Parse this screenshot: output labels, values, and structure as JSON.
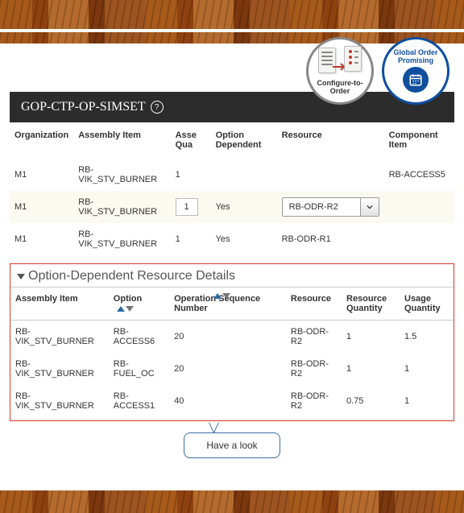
{
  "badges": {
    "c2o_label": "Configure-to-Order",
    "gop_label": "Global Order Promising"
  },
  "title": "GOP-CTP-OP-SIMSET",
  "main_table": {
    "headers": {
      "org": "Organization",
      "assembly_item": "Assembly Item",
      "assembly_qty": "Asse Qua",
      "option_dep": "Option Dependent",
      "resource": "Resource",
      "component_item": "Component Item"
    },
    "rows": [
      {
        "org": "M1",
        "assembly_item": "RB-VIK_STV_BURNER",
        "assembly_qty": "1",
        "option_dep": "",
        "resource": "",
        "component_item": "RB-ACCESS5"
      },
      {
        "org": "M1",
        "assembly_item": "RB-VIK_STV_BURNER",
        "assembly_qty": "1",
        "option_dep": "Yes",
        "resource": "RB-ODR-R2",
        "component_item": ""
      },
      {
        "org": "M1",
        "assembly_item": "RB-VIK_STV_BURNER",
        "assembly_qty": "1",
        "option_dep": "Yes",
        "resource": "RB-ODR-R1",
        "component_item": ""
      }
    ]
  },
  "details": {
    "title": "Option-Dependent Resource Details",
    "headers": {
      "assembly_item": "Assembly Item",
      "option": "Option",
      "op_seq": "Operation Sequence Number",
      "resource": "Resource",
      "res_qty": "Resource Quantity",
      "usage_qty": "Usage Quantity"
    },
    "rows": [
      {
        "assembly_item": "RB-VIK_STV_BURNER",
        "option": "RB-ACCESS6",
        "op_seq": "20",
        "resource": "RB-ODR-R2",
        "res_qty": "1",
        "usage_qty": "1.5"
      },
      {
        "assembly_item": "RB-VIK_STV_BURNER",
        "option": "RB-FUEL_OC",
        "op_seq": "20",
        "resource": "RB-ODR-R2",
        "res_qty": "1",
        "usage_qty": "1"
      },
      {
        "assembly_item": "RB-VIK_STV_BURNER",
        "option": "RB-ACCESS1",
        "op_seq": "40",
        "resource": "RB-ODR-R2",
        "res_qty": "0.75",
        "usage_qty": "1"
      }
    ]
  },
  "callout": "Have  a look"
}
